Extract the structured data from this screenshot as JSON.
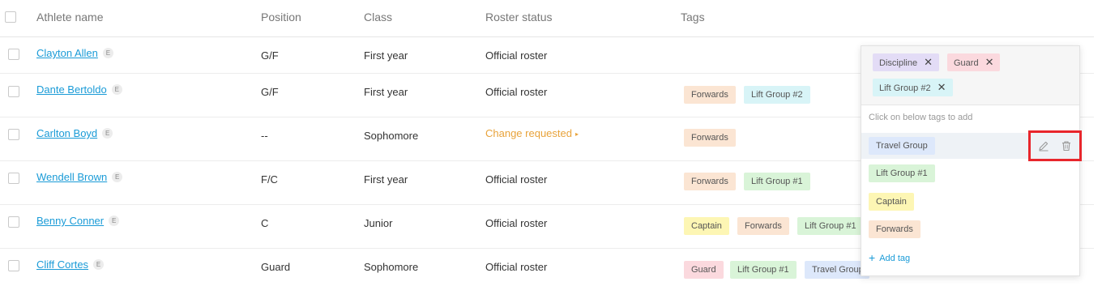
{
  "columns": {
    "athlete_name": "Athlete name",
    "position": "Position",
    "class": "Class",
    "roster_status": "Roster status",
    "tags": "Tags"
  },
  "badge_letter": "E",
  "rows": [
    {
      "name": "Clayton Allen",
      "position": "G/F",
      "class": "First year",
      "status": "Official roster",
      "tags": []
    },
    {
      "name": "Dante Bertoldo",
      "position": "G/F",
      "class": "First year",
      "status": "Official roster",
      "tags": [
        "Forwards",
        "Lift Group #2"
      ]
    },
    {
      "name": "Carlton Boyd",
      "position": "--",
      "class": "Sophomore",
      "status": "Change requested",
      "tags": [
        "Forwards"
      ]
    },
    {
      "name": "Wendell Brown",
      "position": "F/C",
      "class": "First year",
      "status": "Official roster",
      "tags": [
        "Forwards",
        "Lift Group #1"
      ]
    },
    {
      "name": "Benny Conner",
      "position": "C",
      "class": "Junior",
      "status": "Official roster",
      "tags": [
        "Captain",
        "Forwards",
        "Lift Group #1"
      ]
    },
    {
      "name": "Cliff Cortes",
      "position": "Guard",
      "class": "Sophomore",
      "status": "Official roster",
      "tags": [
        "Guard",
        "Lift Group #1",
        "Travel Group"
      ]
    }
  ],
  "status_arrow": "▸",
  "popover": {
    "selected_tags": [
      "Discipline",
      "Guard",
      "Lift Group #2"
    ],
    "hint": "Click on below tags to add",
    "options": [
      "Travel Group",
      "Lift Group #1",
      "Captain",
      "Forwards"
    ],
    "add_tag_label": "Add tag",
    "remove_glyph": "✕",
    "plus_glyph": "+"
  },
  "colors": {
    "link": "#1a9bd7",
    "change_requested": "#e8a33b",
    "highlight_box": "#e8262c",
    "Forwards": "#fbe5d3",
    "Lift Group #1": "#d9f4d8",
    "Lift Group #2": "#d8f4f7",
    "Captain": "#fdf6b4",
    "Guard": "#fbd9de",
    "Travel Group": "#dde8fb",
    "Discipline": "#e3dcf6"
  },
  "icons": {
    "edit": "pencil-icon",
    "delete": "trash-icon"
  }
}
